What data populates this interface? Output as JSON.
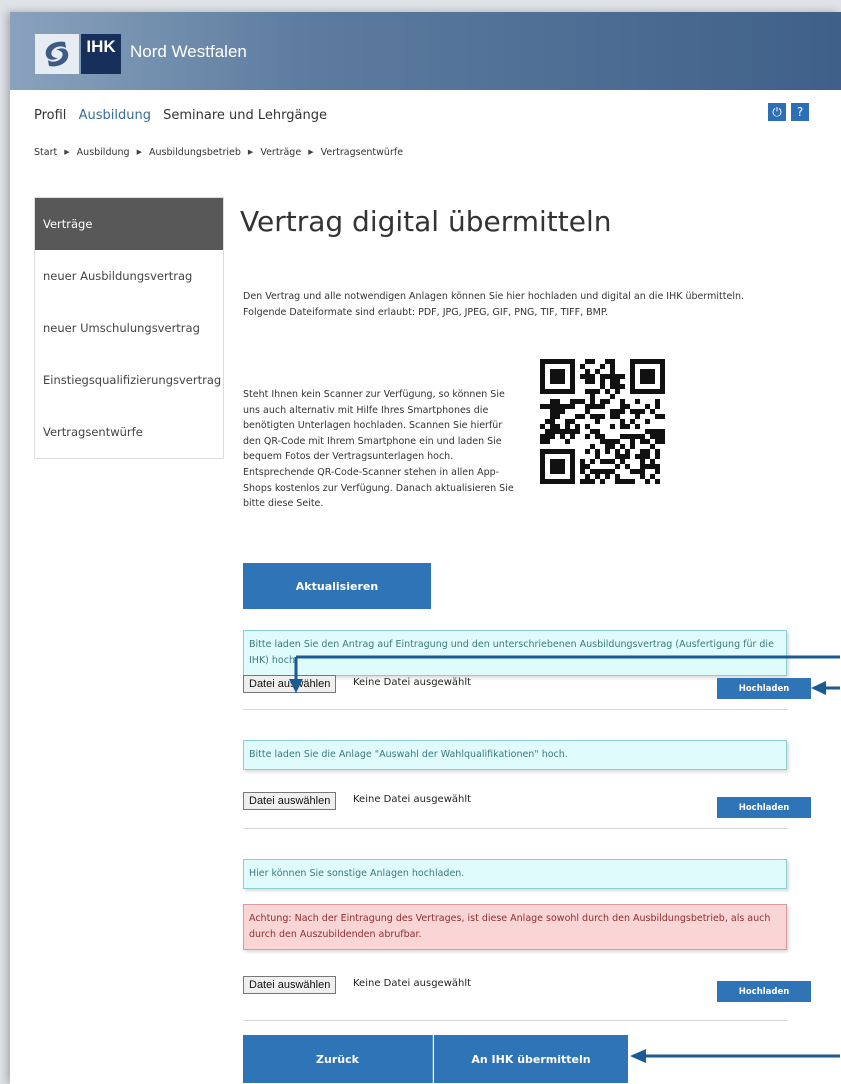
{
  "header": {
    "logo_abbr": "IHK",
    "logo_name": "Nord Westfalen"
  },
  "topnav": {
    "items": [
      "Profil",
      "Ausbildung",
      "Seminare und Lehrgänge"
    ],
    "power_icon": "⏻",
    "help_label": "?"
  },
  "breadcrumb": [
    "Start",
    "Ausbildung",
    "Ausbildungsbetrieb",
    "Verträge",
    "Vertragsentwürfe"
  ],
  "sidebar": {
    "items": [
      {
        "label": "Verträge",
        "active": true
      },
      {
        "label": "neuer Ausbildungsvertrag"
      },
      {
        "label": "neuer Umschulungsvertrag"
      },
      {
        "label": "Einstiegsqualifizierungsvertrag"
      },
      {
        "label": "Vertragsentwürfe"
      }
    ]
  },
  "main": {
    "title": "Vertrag digital übermitteln",
    "intro": "Den Vertrag und alle notwendigen Anlagen können Sie hier hochladen und digital an die IHK übermitteln. Folgende Dateiformate sind erlaubt: PDF, JPG, JPEG, GIF, PNG, TIF, TIFF, BMP.",
    "scanner_text": "Steht Ihnen kein Scanner zur Verfügung, so können Sie uns auch alternativ mit Hilfe Ihres Smartphones die benötigten Unterlagen hochladen. Scannen Sie hierfür den QR-Code mit Ihrem Smartphone ein und laden Sie bequem Fotos der Vertragsunterlagen hoch. Entsprechende QR-Code-Scanner stehen in allen App-Shops kostenlos zur Verfügung. Danach aktualisieren Sie bitte diese Seite.",
    "refresh_label": "Aktualisieren",
    "uploads": [
      {
        "info": "Bitte laden Sie den Antrag auf Eintragung und den unterschriebenen Ausbildungsvertrag (Ausfertigung für die IHK) hoch.",
        "choose_label": "Datei auswählen",
        "status": "Keine Datei ausgewählt",
        "upload_label": "Hochladen"
      },
      {
        "info": "Bitte laden Sie die Anlage \"Auswahl der Wahlqualifikationen\" hoch.",
        "choose_label": "Datei auswählen",
        "status": "Keine Datei ausgewählt",
        "upload_label": "Hochladen"
      },
      {
        "info": "Hier können Sie sonstige Anlagen hochladen.",
        "warning": "Achtung: Nach der Eintragung des Vertrages, ist diese Anlage sowohl durch den Ausbildungsbetrieb, als auch durch den Auszubildenden abrufbar.",
        "choose_label": "Datei auswählen",
        "status": "Keine Datei ausgewählt",
        "upload_label": "Hochladen"
      }
    ],
    "back_label": "Zurück",
    "submit_label": "An IHK übermitteln"
  },
  "colors": {
    "accent": "#2f74b6",
    "header_dark": "#3f6089",
    "info_bg": "#dffbfb",
    "warning_bg": "#f9d5d5",
    "annotation_arrow": "#1a5a96"
  },
  "icons": {
    "breadcrumb_separator": "▶",
    "logo": "ihk-swirl-icon",
    "qr": "qr-code-icon"
  }
}
